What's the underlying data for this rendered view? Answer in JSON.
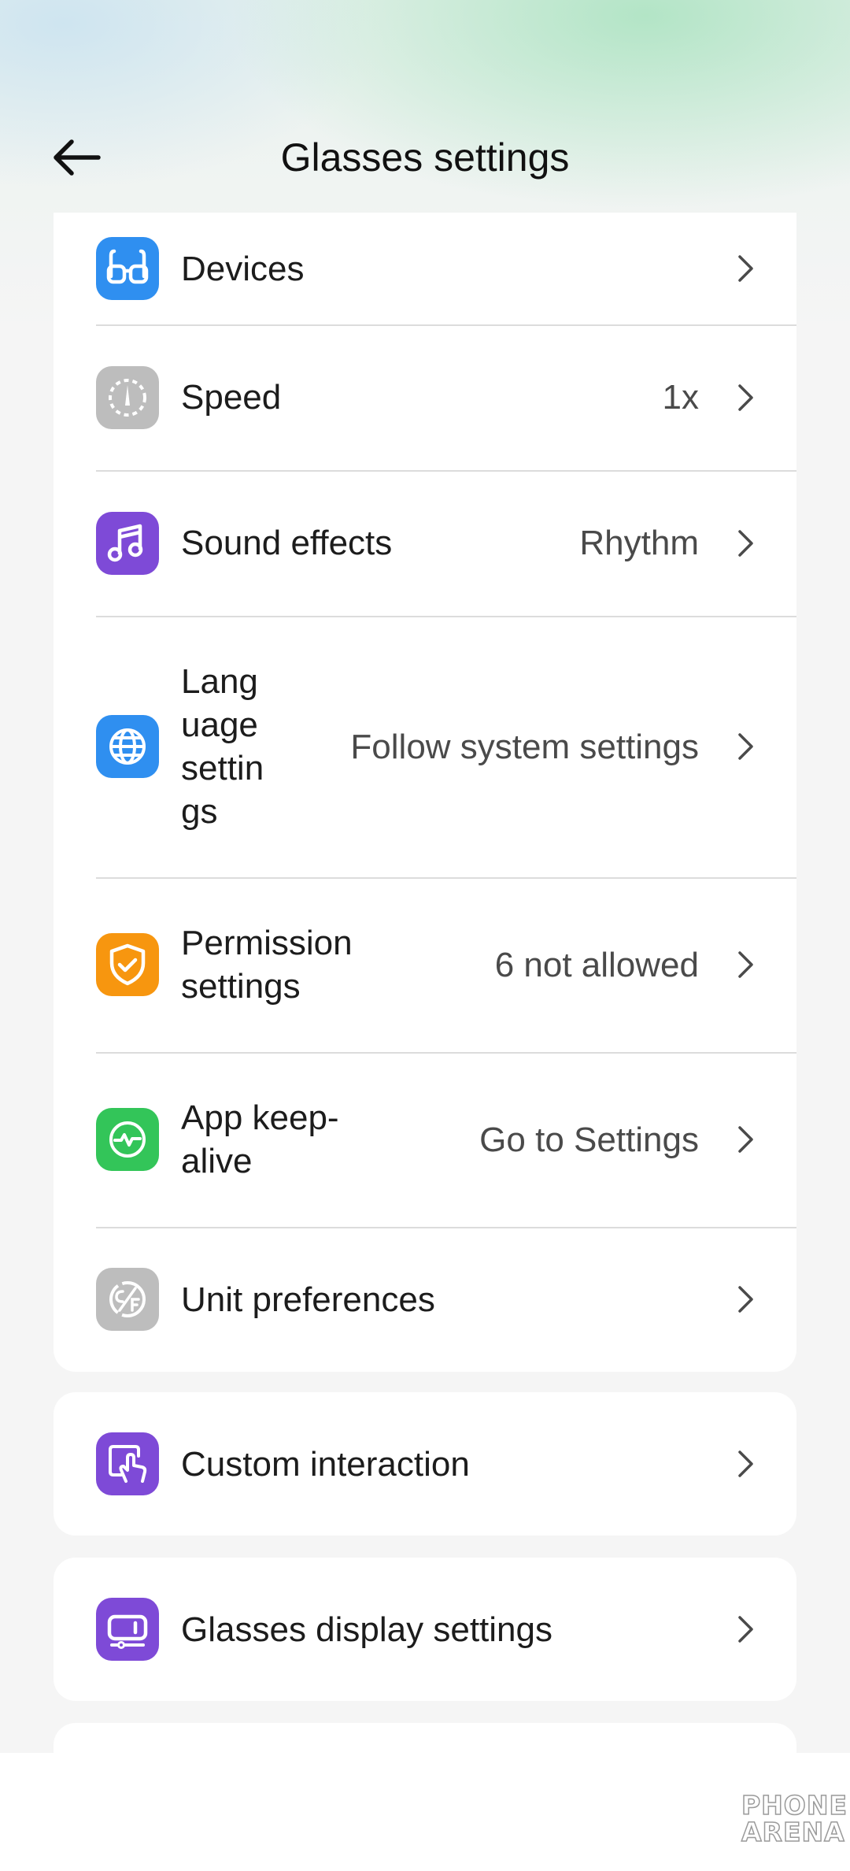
{
  "header": {
    "title": "Glasses settings"
  },
  "settings_group_1": [
    {
      "label": "Devices",
      "value": "",
      "icon": "glasses-icon",
      "icon_color": "#2f8ff0"
    },
    {
      "label": "Speed",
      "value": "1x",
      "icon": "speedometer-icon",
      "icon_color": "#bdbdbd"
    },
    {
      "label": "Sound effects",
      "value": "Rhythm",
      "icon": "music-note-icon",
      "icon_color": "#7e4ad7"
    },
    {
      "label": "Lang uage settin gs",
      "value": "Follow system settings",
      "icon": "globe-icon",
      "icon_color": "#2f8ff0"
    },
    {
      "label": "Permission settings",
      "value": "6 not allowed",
      "icon": "shield-check-icon",
      "icon_color": "#f7960f"
    },
    {
      "label": "App keep-alive",
      "value": "Go to Settings",
      "icon": "heartbeat-icon",
      "icon_color": "#33c559"
    },
    {
      "label": "Unit preferences",
      "value": "",
      "icon": "temperature-unit-icon",
      "icon_color": "#bdbdbd"
    }
  ],
  "settings_group_2": [
    {
      "label": "Custom interaction",
      "icon": "touch-gesture-icon",
      "icon_color": "#7e4ad7"
    }
  ],
  "settings_group_3": [
    {
      "label": "Glasses display settings",
      "icon": "display-adjust-icon",
      "icon_color": "#7e4ad7"
    }
  ],
  "watermark": {
    "line1": "PHONE",
    "line2": "ARENA"
  }
}
